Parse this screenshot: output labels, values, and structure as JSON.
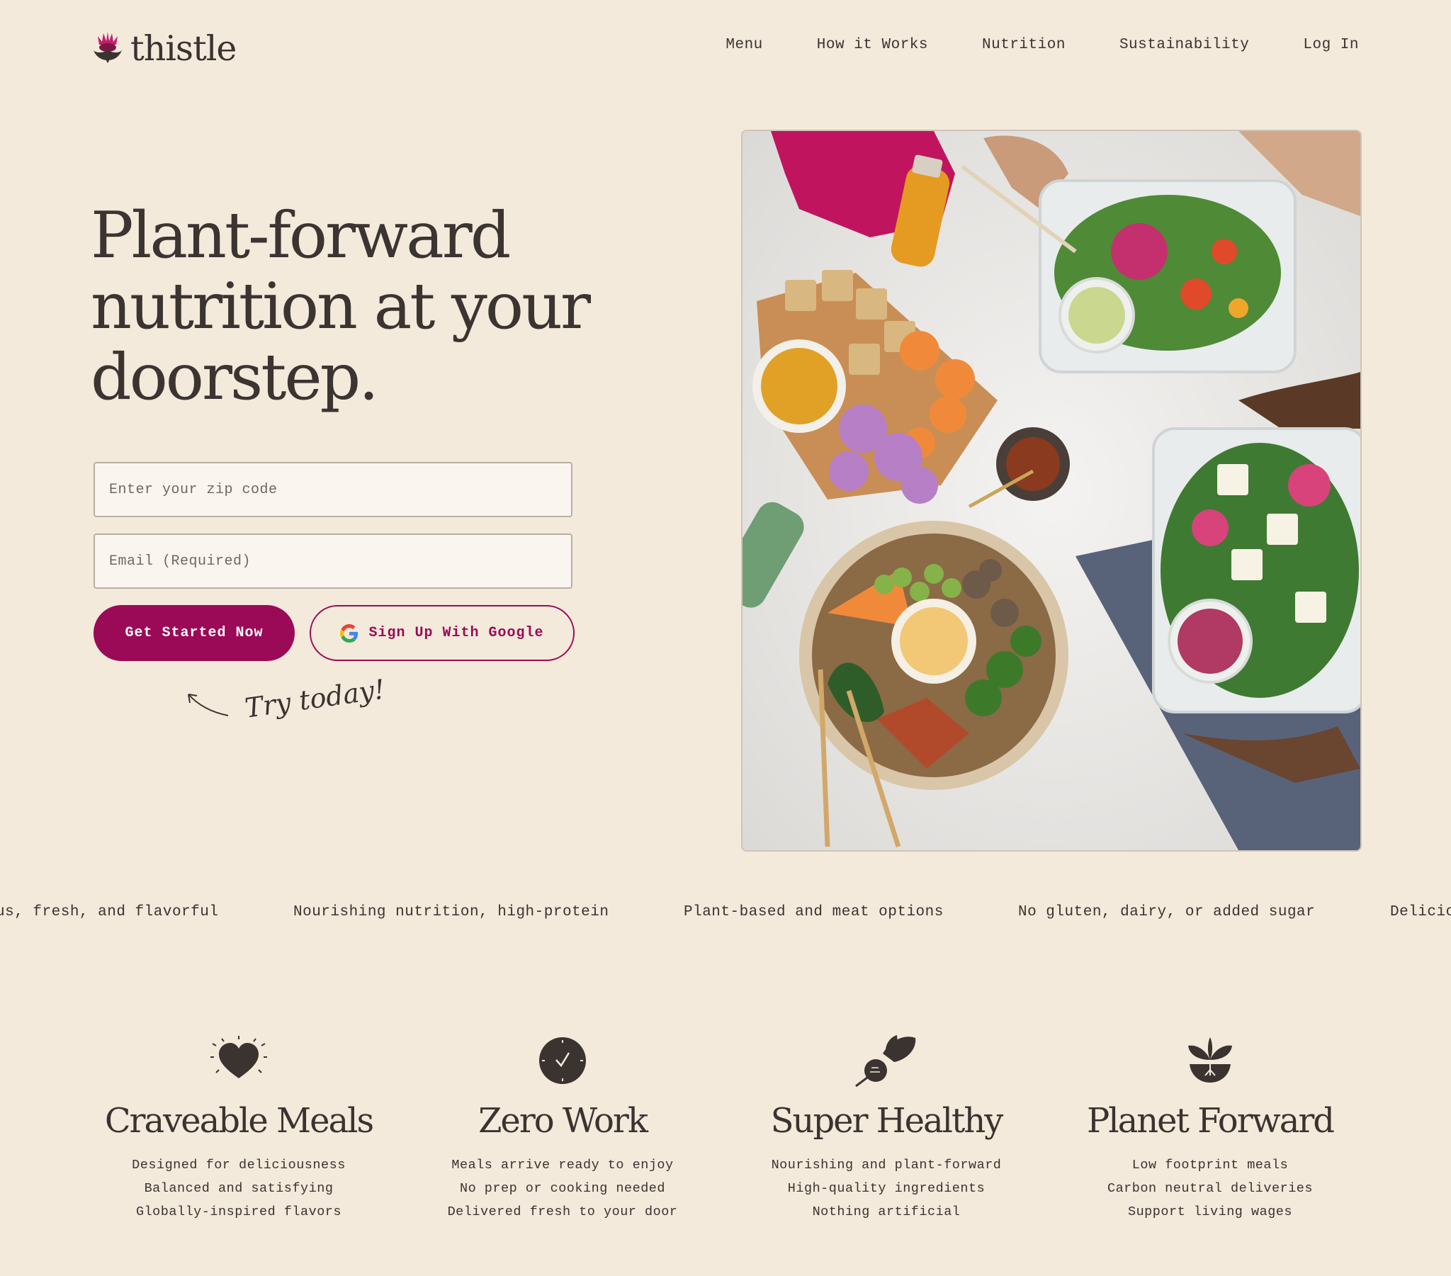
{
  "brand": {
    "name": "thistle",
    "accent": "#9b0a56"
  },
  "nav": {
    "items": [
      "Menu",
      "How it Works",
      "Nutrition",
      "Sustainability",
      "Log In"
    ]
  },
  "hero": {
    "headline": "Plant-forward nutrition at your doorstep.",
    "zip_placeholder": "Enter your zip code",
    "email_placeholder": "Email (Required)",
    "cta_primary": "Get Started Now",
    "cta_google": "Sign Up With Google",
    "try_note": "Try today!"
  },
  "ticker": [
    "us, fresh, and flavorful",
    "Nourishing nutrition, high-protein",
    "Plant-based and meat options",
    "No gluten, dairy, or added sugar",
    "Delicio"
  ],
  "features": [
    {
      "icon": "heart-icon",
      "title": "Craveable Meals",
      "lines": [
        "Designed for deliciousness",
        "Balanced and satisfying",
        "Globally-inspired flavors"
      ]
    },
    {
      "icon": "clock-icon",
      "title": "Zero Work",
      "lines": [
        "Meals arrive ready to enjoy",
        "No prep or cooking needed",
        "Delivered fresh to your door"
      ]
    },
    {
      "icon": "beet-icon",
      "title": "Super Healthy",
      "lines": [
        "Nourishing and plant-forward",
        "High-quality ingredients",
        "Nothing artificial"
      ]
    },
    {
      "icon": "sprout-icon",
      "title": "Planet Forward",
      "lines": [
        "Low footprint meals",
        "Carbon neutral deliveries",
        "Support living wages"
      ]
    }
  ]
}
